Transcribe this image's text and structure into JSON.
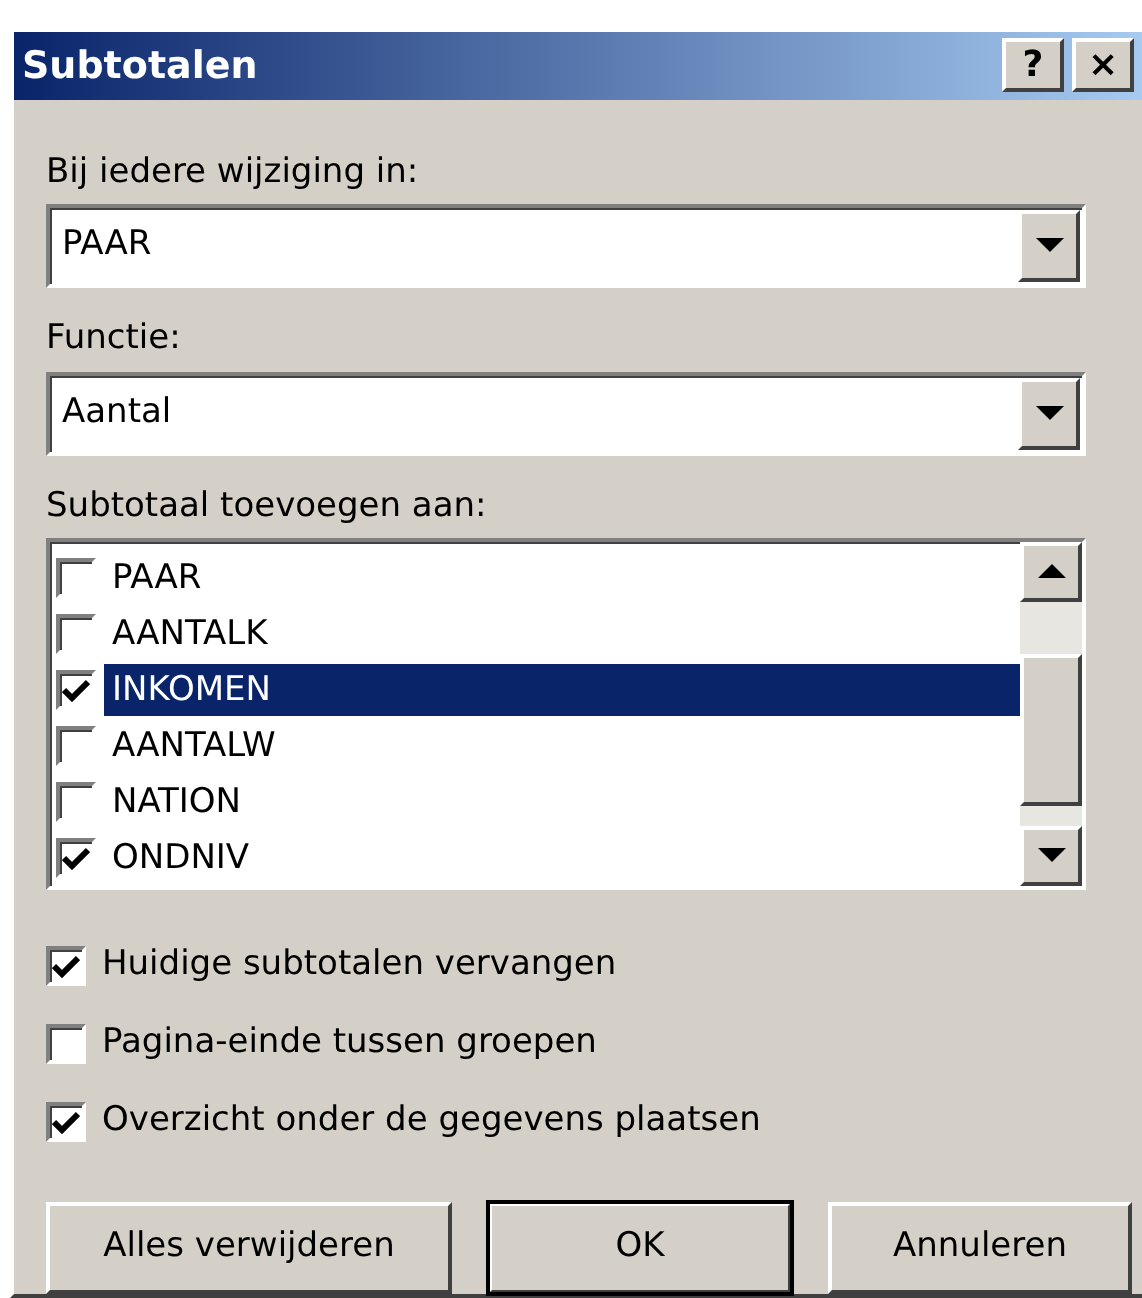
{
  "window": {
    "title": "Subtotalen",
    "title_buttons": [
      "?",
      "×"
    ]
  },
  "change_field": {
    "label": "Bij iedere wijziging in:",
    "value": "PAAR"
  },
  "function_field": {
    "label": "Functie:",
    "value": "Aantal"
  },
  "add_to": {
    "label": "Subtotaal toevoegen aan:",
    "items": [
      {
        "label": "PAAR",
        "checked": false,
        "selected": false
      },
      {
        "label": "AANTALK",
        "checked": false,
        "selected": false
      },
      {
        "label": "INKOMEN",
        "checked": true,
        "selected": true
      },
      {
        "label": "AANTALW",
        "checked": false,
        "selected": false
      },
      {
        "label": "NATION",
        "checked": false,
        "selected": false
      },
      {
        "label": "ONDNIV",
        "checked": true,
        "selected": false
      }
    ]
  },
  "options": [
    {
      "label": "Huidige subtotalen vervangen",
      "checked": true
    },
    {
      "label": "Pagina-einde tussen groepen",
      "checked": false
    },
    {
      "label": "Overzicht onder de gegevens plaatsen",
      "checked": true
    }
  ],
  "buttons": [
    {
      "label": "Alles verwijderen",
      "default": false
    },
    {
      "label": "OK",
      "default": true
    },
    {
      "label": "Annuleren",
      "default": false
    }
  ]
}
